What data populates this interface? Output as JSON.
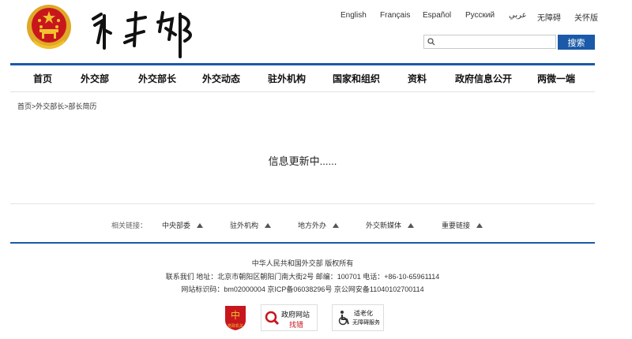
{
  "languages": [
    "English",
    "Français",
    "Español",
    "Русский",
    "عربي",
    "无障碍",
    "关怀版"
  ],
  "search": {
    "placeholder": "",
    "button_label": "搜索"
  },
  "nav": [
    "首页",
    "外交部",
    "外交部长",
    "外交动态",
    "驻外机构",
    "国家和组织",
    "资料",
    "政府信息公开",
    "两微一端"
  ],
  "breadcrumb": "首页>外交部长>部长简历",
  "content": {
    "message": "信息更新中......"
  },
  "related": {
    "label": "相关链接：",
    "items": [
      "中央部委",
      "驻外机构",
      "地方外办",
      "外交新媒体",
      "重要链接"
    ]
  },
  "footer": {
    "line1": "中华人民共和国外交部    版权所有",
    "line2": "联系我们    地址：北京市朝阳区朝阳门南大街2号    邮编：100701    电话：+86-10-65961114",
    "line3": "网站标识码：bm02000004    京ICP备06038296号    京公网安备11040102700114"
  },
  "badges": {
    "party_label": "党政机关",
    "gov_site_title": "政府网站",
    "gov_site_sub": "找错",
    "accessible_title": "适老化",
    "accessible_sub": "无障碍服务"
  },
  "colors": {
    "accent": "#1a5aa8",
    "emblem_red": "#c8161d",
    "emblem_gold": "#f2c12e"
  }
}
